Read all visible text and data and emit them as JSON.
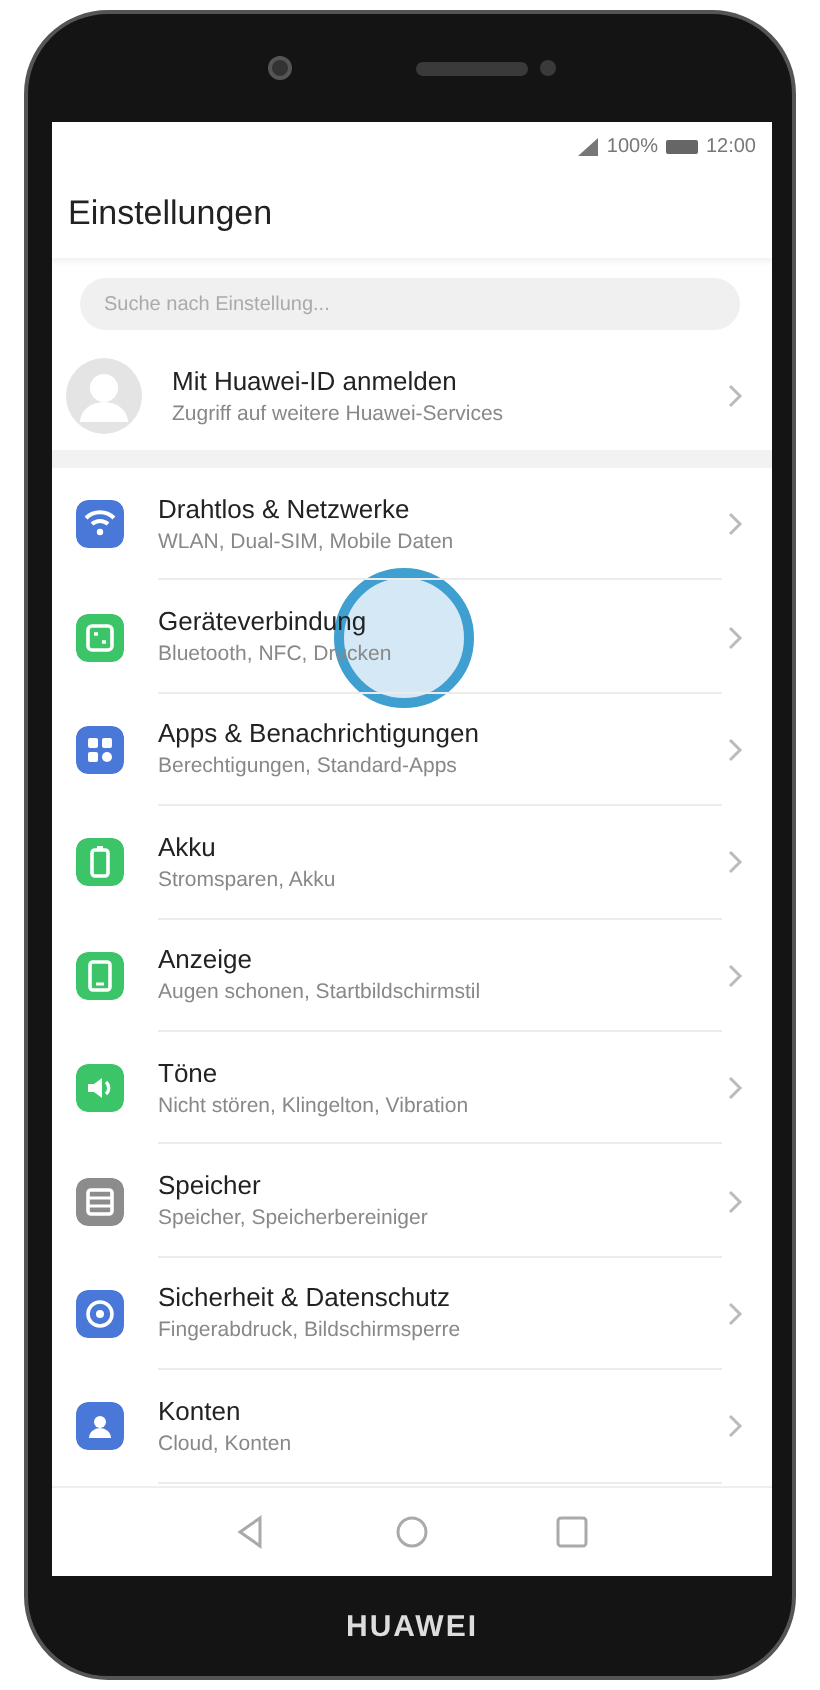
{
  "status_bar": {
    "battery_percent": "100%",
    "time": "12:00"
  },
  "header": {
    "title": "Einstellungen"
  },
  "search": {
    "placeholder": "Suche nach Einstellung..."
  },
  "account": {
    "title": "Mit Huawei-ID anmelden",
    "subtitle": "Zugriff auf weitere Huawei-Services"
  },
  "items": [
    {
      "kind": "wifi",
      "color": "#4a78d8",
      "title": "Drahtlos & Netzwerke",
      "subtitle": "WLAN, Dual-SIM, Mobile Daten",
      "touched": false
    },
    {
      "kind": "devices",
      "color": "#3cc468",
      "title": "Geräteverbindung",
      "subtitle": "Bluetooth, NFC, Drucken",
      "touched": true
    },
    {
      "kind": "apps",
      "color": "#4a78d8",
      "title": "Apps & Benachrichtigungen",
      "subtitle": "Berechtigungen, Standard-Apps",
      "touched": false
    },
    {
      "kind": "battery",
      "color": "#3cc468",
      "title": "Akku",
      "subtitle": "Stromsparen, Akku",
      "touched": false
    },
    {
      "kind": "display",
      "color": "#3cc468",
      "title": "Anzeige",
      "subtitle": "Augen schonen, Startbildschirmstil",
      "touched": false
    },
    {
      "kind": "sound",
      "color": "#3cc468",
      "title": "Töne",
      "subtitle": "Nicht stören, Klingelton, Vibration",
      "touched": false
    },
    {
      "kind": "storage",
      "color": "#8c8c8c",
      "title": "Speicher",
      "subtitle": "Speicher, Speicherbereiniger",
      "touched": false
    },
    {
      "kind": "security",
      "color": "#4a78d8",
      "title": "Sicherheit & Datenschutz",
      "subtitle": "Fingerabdruck, Bildschirmsperre",
      "touched": false
    },
    {
      "kind": "account",
      "color": "#4a78d8",
      "title": "Konten",
      "subtitle": "Cloud, Konten",
      "touched": false
    }
  ],
  "brand": "HUAWEI"
}
